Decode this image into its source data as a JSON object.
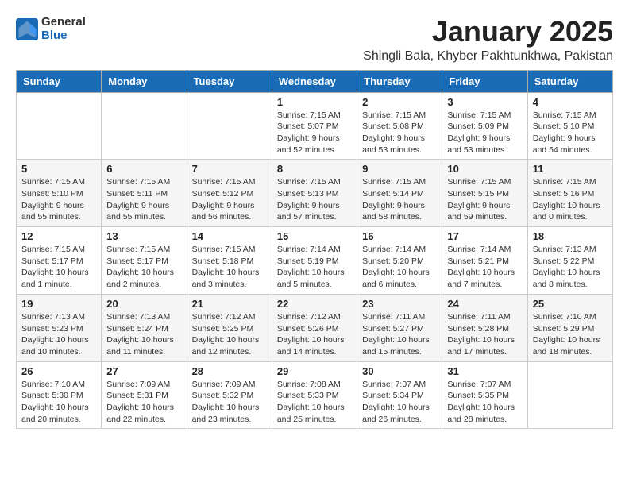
{
  "header": {
    "logo_general": "General",
    "logo_blue": "Blue",
    "month_title": "January 2025",
    "subtitle": "Shingli Bala, Khyber Pakhtunkhwa, Pakistan"
  },
  "weekdays": [
    "Sunday",
    "Monday",
    "Tuesday",
    "Wednesday",
    "Thursday",
    "Friday",
    "Saturday"
  ],
  "weeks": [
    [
      {
        "day": "",
        "info": ""
      },
      {
        "day": "",
        "info": ""
      },
      {
        "day": "",
        "info": ""
      },
      {
        "day": "1",
        "info": "Sunrise: 7:15 AM\nSunset: 5:07 PM\nDaylight: 9 hours\nand 52 minutes."
      },
      {
        "day": "2",
        "info": "Sunrise: 7:15 AM\nSunset: 5:08 PM\nDaylight: 9 hours\nand 53 minutes."
      },
      {
        "day": "3",
        "info": "Sunrise: 7:15 AM\nSunset: 5:09 PM\nDaylight: 9 hours\nand 53 minutes."
      },
      {
        "day": "4",
        "info": "Sunrise: 7:15 AM\nSunset: 5:10 PM\nDaylight: 9 hours\nand 54 minutes."
      }
    ],
    [
      {
        "day": "5",
        "info": "Sunrise: 7:15 AM\nSunset: 5:10 PM\nDaylight: 9 hours\nand 55 minutes."
      },
      {
        "day": "6",
        "info": "Sunrise: 7:15 AM\nSunset: 5:11 PM\nDaylight: 9 hours\nand 55 minutes."
      },
      {
        "day": "7",
        "info": "Sunrise: 7:15 AM\nSunset: 5:12 PM\nDaylight: 9 hours\nand 56 minutes."
      },
      {
        "day": "8",
        "info": "Sunrise: 7:15 AM\nSunset: 5:13 PM\nDaylight: 9 hours\nand 57 minutes."
      },
      {
        "day": "9",
        "info": "Sunrise: 7:15 AM\nSunset: 5:14 PM\nDaylight: 9 hours\nand 58 minutes."
      },
      {
        "day": "10",
        "info": "Sunrise: 7:15 AM\nSunset: 5:15 PM\nDaylight: 9 hours\nand 59 minutes."
      },
      {
        "day": "11",
        "info": "Sunrise: 7:15 AM\nSunset: 5:16 PM\nDaylight: 10 hours\nand 0 minutes."
      }
    ],
    [
      {
        "day": "12",
        "info": "Sunrise: 7:15 AM\nSunset: 5:17 PM\nDaylight: 10 hours\nand 1 minute."
      },
      {
        "day": "13",
        "info": "Sunrise: 7:15 AM\nSunset: 5:17 PM\nDaylight: 10 hours\nand 2 minutes."
      },
      {
        "day": "14",
        "info": "Sunrise: 7:15 AM\nSunset: 5:18 PM\nDaylight: 10 hours\nand 3 minutes."
      },
      {
        "day": "15",
        "info": "Sunrise: 7:14 AM\nSunset: 5:19 PM\nDaylight: 10 hours\nand 5 minutes."
      },
      {
        "day": "16",
        "info": "Sunrise: 7:14 AM\nSunset: 5:20 PM\nDaylight: 10 hours\nand 6 minutes."
      },
      {
        "day": "17",
        "info": "Sunrise: 7:14 AM\nSunset: 5:21 PM\nDaylight: 10 hours\nand 7 minutes."
      },
      {
        "day": "18",
        "info": "Sunrise: 7:13 AM\nSunset: 5:22 PM\nDaylight: 10 hours\nand 8 minutes."
      }
    ],
    [
      {
        "day": "19",
        "info": "Sunrise: 7:13 AM\nSunset: 5:23 PM\nDaylight: 10 hours\nand 10 minutes."
      },
      {
        "day": "20",
        "info": "Sunrise: 7:13 AM\nSunset: 5:24 PM\nDaylight: 10 hours\nand 11 minutes."
      },
      {
        "day": "21",
        "info": "Sunrise: 7:12 AM\nSunset: 5:25 PM\nDaylight: 10 hours\nand 12 minutes."
      },
      {
        "day": "22",
        "info": "Sunrise: 7:12 AM\nSunset: 5:26 PM\nDaylight: 10 hours\nand 14 minutes."
      },
      {
        "day": "23",
        "info": "Sunrise: 7:11 AM\nSunset: 5:27 PM\nDaylight: 10 hours\nand 15 minutes."
      },
      {
        "day": "24",
        "info": "Sunrise: 7:11 AM\nSunset: 5:28 PM\nDaylight: 10 hours\nand 17 minutes."
      },
      {
        "day": "25",
        "info": "Sunrise: 7:10 AM\nSunset: 5:29 PM\nDaylight: 10 hours\nand 18 minutes."
      }
    ],
    [
      {
        "day": "26",
        "info": "Sunrise: 7:10 AM\nSunset: 5:30 PM\nDaylight: 10 hours\nand 20 minutes."
      },
      {
        "day": "27",
        "info": "Sunrise: 7:09 AM\nSunset: 5:31 PM\nDaylight: 10 hours\nand 22 minutes."
      },
      {
        "day": "28",
        "info": "Sunrise: 7:09 AM\nSunset: 5:32 PM\nDaylight: 10 hours\nand 23 minutes."
      },
      {
        "day": "29",
        "info": "Sunrise: 7:08 AM\nSunset: 5:33 PM\nDaylight: 10 hours\nand 25 minutes."
      },
      {
        "day": "30",
        "info": "Sunrise: 7:07 AM\nSunset: 5:34 PM\nDaylight: 10 hours\nand 26 minutes."
      },
      {
        "day": "31",
        "info": "Sunrise: 7:07 AM\nSunset: 5:35 PM\nDaylight: 10 hours\nand 28 minutes."
      },
      {
        "day": "",
        "info": ""
      }
    ]
  ]
}
